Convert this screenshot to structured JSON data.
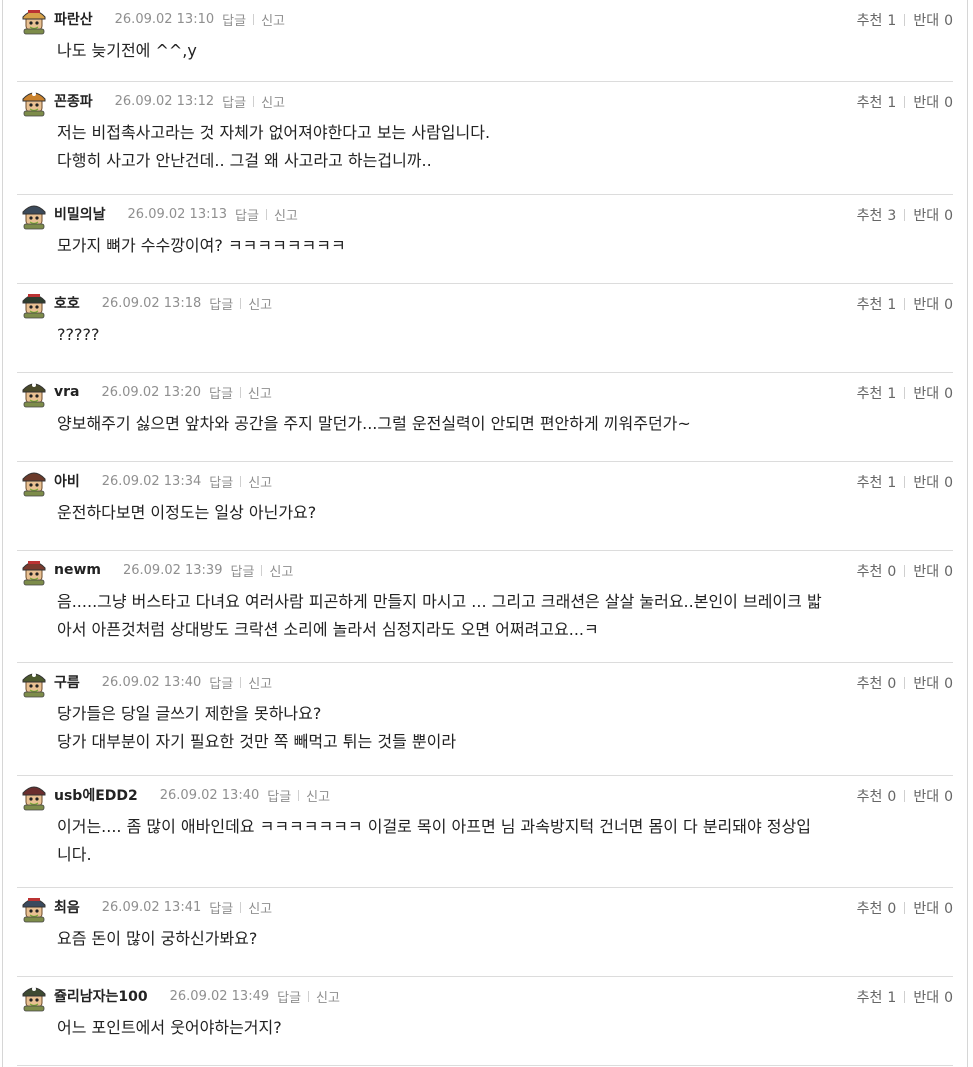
{
  "labels": {
    "reply": "답글",
    "report": "신고",
    "upvote": "추천",
    "downvote": "반대"
  },
  "comments": [
    {
      "nick": "파란산",
      "date": "26.09.02 13:10",
      "up": "1",
      "down": "0",
      "avatar_color": "#d7a24a",
      "lines": [
        "나도 늦기전에 ^^,y"
      ]
    },
    {
      "nick": "꼰종파",
      "date": "26.09.02 13:12",
      "up": "1",
      "down": "0",
      "avatar_color": "#c9822e",
      "lines": [
        "저는 비접촉사고라는 것 자체가 없어져야한다고 보는 사람입니다.",
        "다행히 사고가 안난건데.. 그걸 왜 사고라고 하는겁니까.."
      ]
    },
    {
      "nick": "비밀의날",
      "date": "26.09.02 13:13",
      "up": "3",
      "down": "0",
      "avatar_color": "#3b4a5a",
      "lines": [
        "모가지 뼈가 수수깡이여? ㅋㅋㅋㅋㅋㅋㅋㅋ"
      ]
    },
    {
      "nick": "호호",
      "date": "26.09.02 13:18",
      "up": "1",
      "down": "0",
      "avatar_color": "#2e3d2e",
      "lines": [
        "?????"
      ]
    },
    {
      "nick": "vra",
      "date": "26.09.02 13:20",
      "up": "1",
      "down": "0",
      "avatar_color": "#4a4a2a",
      "lines": [
        "양보해주기 싫으면 앞차와 공간을 주지 말던가...그럴 운전실력이 안되면 편안하게 끼워주던가~"
      ]
    },
    {
      "nick": "아비",
      "date": "26.09.02 13:34",
      "up": "1",
      "down": "0",
      "avatar_color": "#6b3a2a",
      "lines": [
        "운전하다보면 이정도는 일상 아닌가요?"
      ]
    },
    {
      "nick": "newm",
      "date": "26.09.02 13:39",
      "up": "0",
      "down": "0",
      "avatar_color": "#7a3b2e",
      "lines": [
        "음.....그냥 버스타고 다녀요 여러사람 피곤하게 만들지 마시고 ... 그리고 크래션은 살살 눌러요..본인이 브레이크 밟",
        "아서 아픈것처럼 상대방도 크락션 소리에 놀라서 심정지라도 오면 어쩌려고요...ㅋ"
      ]
    },
    {
      "nick": "구름",
      "date": "26.09.02 13:40",
      "up": "0",
      "down": "0",
      "avatar_color": "#4d5a2e",
      "lines": [
        "당가들은 당일 글쓰기 제한을 못하나요?",
        "당가 대부분이 자기 필요한 것만 쪽 빼먹고 튀는 것들 뿐이라"
      ]
    },
    {
      "nick": "usb에EDD2",
      "date": "26.09.02 13:40",
      "up": "0",
      "down": "0",
      "avatar_color": "#6a2e2e",
      "lines": [
        "이거는.... 좀 많이 애바인데요 ㅋㅋㅋㅋㅋㅋㅋ 이걸로 목이 아프면 님 과속방지턱 건너면 몸이 다 분리돼야 정상입",
        "니다."
      ]
    },
    {
      "nick": "최음",
      "date": "26.09.02 13:41",
      "up": "0",
      "down": "0",
      "avatar_color": "#3a4a5e",
      "lines": [
        "요즘 돈이 많이 궁하신가봐요?"
      ]
    },
    {
      "nick": "쥴리남자는100",
      "date": "26.09.02 13:49",
      "up": "1",
      "down": "0",
      "avatar_color": "#3e4a32",
      "lines": [
        "어느 포인트에서 웃어야하는거지?"
      ]
    }
  ]
}
